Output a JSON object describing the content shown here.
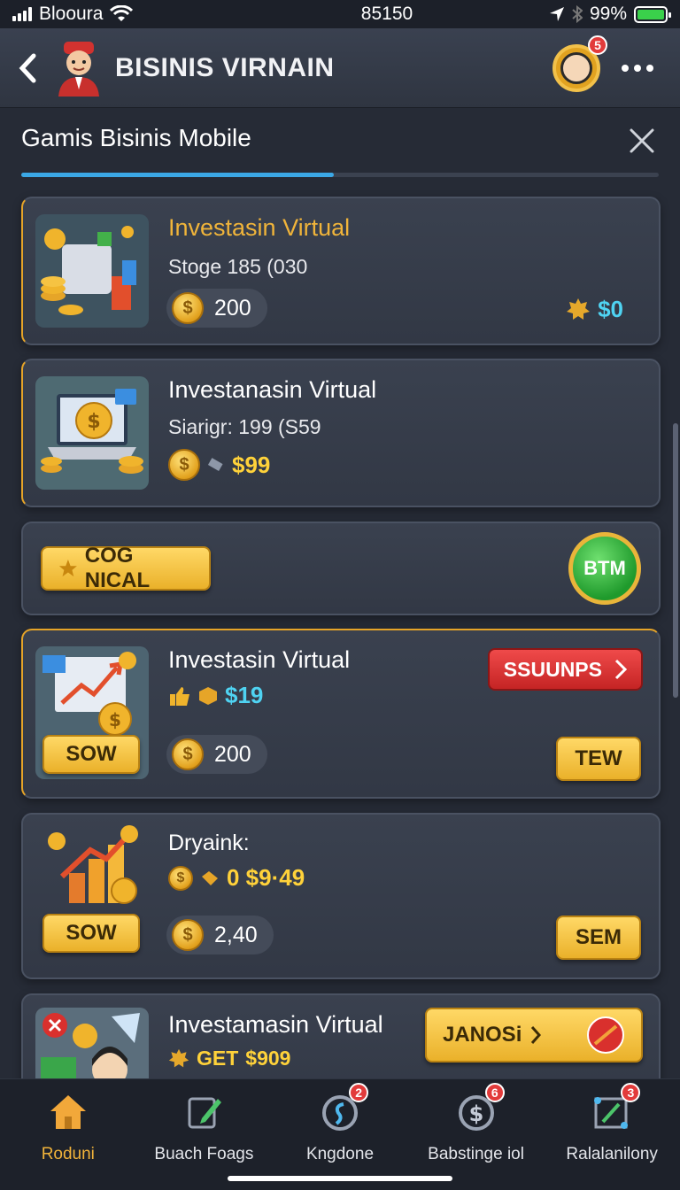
{
  "status_bar": {
    "carrier": "Bloοura",
    "time": "85150",
    "battery_percent_text": "99%",
    "battery_level": 0.99
  },
  "header": {
    "title": "BISINIS VIRNAIN",
    "profile_badge": "5"
  },
  "subheader": {
    "title": "Gamis Bisinis Mobile",
    "progress": 0.49
  },
  "cards": [
    {
      "title": "Investasin Virtual",
      "line2": "Stoge 185 (030",
      "coin_value": "200",
      "reward_value": "$0"
    },
    {
      "title": "Investanasin Virtual",
      "line2": "Siarigr: 199 (S59",
      "value": "$99"
    },
    {
      "button_label": "COG NICAL",
      "circle_label": "BTM"
    },
    {
      "title": "Investasin Virtual",
      "value": "$19",
      "coin_value": "200",
      "red_button_label": "SSUUNPS",
      "thumb_button_label": "SOW",
      "side_button_label": "TEW"
    },
    {
      "title": "Dryaink:",
      "value": "0 $9·49",
      "coin_value": "2,40",
      "thumb_button_label": "SOW",
      "side_button_label": "SEM"
    },
    {
      "title": "Investamasin Virtual",
      "value_prefix": "GET",
      "value": "$909",
      "button_label": "JANOSi"
    }
  ],
  "bottom_nav": [
    {
      "label": "Roduni",
      "icon": "home-icon",
      "active": true
    },
    {
      "label": "Buach Foags",
      "icon": "edit-icon",
      "badge": ""
    },
    {
      "label": "Kngdone",
      "icon": "refresh-icon",
      "badge": "2"
    },
    {
      "label": "Babstinge iol",
      "icon": "dollar-icon",
      "badge": "6"
    },
    {
      "label": "Ralalanilony",
      "icon": "network-icon",
      "badge": "3"
    }
  ],
  "colors": {
    "accent_gold": "#f0b43a",
    "accent_cyan": "#4fd3f2",
    "progress_blue": "#3ba8e6",
    "danger_red": "#d83232"
  }
}
